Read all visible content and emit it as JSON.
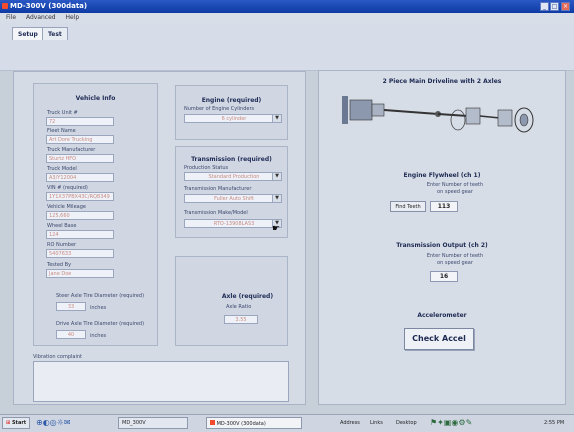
{
  "window": {
    "title": "MD-300V (300data)",
    "minimize": "_",
    "maximize": "□",
    "close": "×"
  },
  "menu": {
    "items": [
      "File",
      "Advanced",
      "Help"
    ]
  },
  "tabs": [
    "Setup",
    "Test"
  ],
  "vehicle_info": {
    "header": "Vehicle Info",
    "fields": [
      {
        "label": "Truck Unit #",
        "value": "72"
      },
      {
        "label": "Fleet Name",
        "value": "Art Dore Trucking"
      },
      {
        "label": "Truck Manufacturer",
        "value": "Sturtz HFO"
      },
      {
        "label": "Truck Model",
        "value": "A3/Y12004"
      },
      {
        "label": "VIN # (required)",
        "value": "1Y1X37PBX43C/RQ8349"
      },
      {
        "label": "Vehicle Mileage",
        "value": "125,660"
      },
      {
        "label": "Wheel Base",
        "value": "124"
      },
      {
        "label": "RO Number",
        "value": "5407633"
      },
      {
        "label": "Tested By",
        "value": "Jane Doe"
      }
    ],
    "steer_axle": {
      "label": "Steer Axle Tire Diameter (required)",
      "value": "33",
      "unit": "inches"
    },
    "drive_axle": {
      "label": "Drive Axle Tire Diameter (required)",
      "value": "40",
      "unit": "inches"
    }
  },
  "engine": {
    "header": "Engine (required)",
    "cylinders_label": "Number of Engine Cylinders",
    "cylinders_value": "6 cylinder"
  },
  "transmission": {
    "header": "Transmission (required)",
    "production_status_label": "Production Status",
    "production_status_value": "Standard Production",
    "manufacturer_label": "Transmission Manufacturer",
    "manufacturer_value": "Fuller Auto Shift",
    "make_model_label": "Transmission Make/Model",
    "make_model_value": "RTO-13908LAS3"
  },
  "axle": {
    "header": "Axle (required)",
    "ratio_label": "Axle Ratio",
    "ratio_value": "3.55"
  },
  "complaint": {
    "label": "Vibration complaint",
    "value": ""
  },
  "right": {
    "driveline_title": "2 Piece Main Driveline with 2 Axles",
    "flywheel_title": "Engine Flywheel (ch 1)",
    "flywheel_hint_1": "Enter Number of teeth",
    "flywheel_hint_2": "on speed gear",
    "find_teeth": "Find Teeth",
    "flywheel_teeth": "113",
    "output_title": "Transmission Output (ch 2)",
    "output_hint_1": "Enter Number of teeth",
    "output_hint_2": "on speed gear",
    "output_teeth": "16",
    "accel_title": "Accelerometer",
    "check_accel": "Check Accel"
  },
  "taskbar": {
    "start": "Start",
    "task1": "MD_300V",
    "task2": "MD-300V (300data)",
    "address": "Address",
    "links": "Links",
    "desktop": "Desktop",
    "clock": "2:55 PM"
  }
}
